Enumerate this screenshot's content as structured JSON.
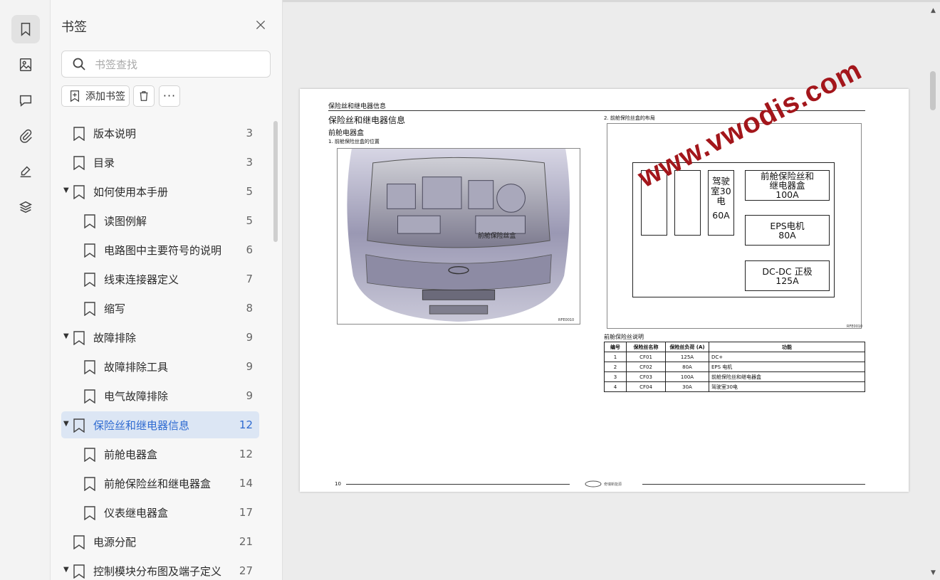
{
  "sidebar_rail": {
    "icons": [
      "bookmark-icon",
      "image-icon",
      "comment-icon",
      "attachment-icon",
      "signature-icon",
      "layers-icon"
    ],
    "active": "bookmark-icon"
  },
  "bookmarks_panel": {
    "title": "书签",
    "search_placeholder": "书签查找",
    "add_label": "添加书签",
    "items": [
      {
        "label": "版本说明",
        "page": "3",
        "level": 0,
        "expanded": false
      },
      {
        "label": "目录",
        "page": "3",
        "level": 0,
        "expanded": false
      },
      {
        "label": "如何使用本手册",
        "page": "5",
        "level": 0,
        "expanded": true
      },
      {
        "label": "读图例解",
        "page": "5",
        "level": 1,
        "expanded": false
      },
      {
        "label": "电路图中主要符号的说明",
        "page": "6",
        "level": 1,
        "expanded": false
      },
      {
        "label": "线束连接器定义",
        "page": "7",
        "level": 1,
        "expanded": false
      },
      {
        "label": "缩写",
        "page": "8",
        "level": 1,
        "expanded": false
      },
      {
        "label": "故障排除",
        "page": "9",
        "level": 0,
        "expanded": true
      },
      {
        "label": "故障排除工具",
        "page": "9",
        "level": 1,
        "expanded": false
      },
      {
        "label": "电气故障排除",
        "page": "9",
        "level": 1,
        "expanded": false
      },
      {
        "label": "保险丝和继电器信息",
        "page": "12",
        "level": 0,
        "expanded": true,
        "selected": true
      },
      {
        "label": "前舱电器盒",
        "page": "12",
        "level": 1,
        "expanded": false
      },
      {
        "label": "前舱保险丝和继电器盒",
        "page": "14",
        "level": 1,
        "expanded": false
      },
      {
        "label": "仪表继电器盒",
        "page": "17",
        "level": 1,
        "expanded": false
      },
      {
        "label": "电源分配",
        "page": "21",
        "level": 0,
        "expanded": false
      },
      {
        "label": "控制模块分布图及端子定义",
        "page": "27",
        "level": 0,
        "expanded": true
      }
    ]
  },
  "document_page": {
    "header": "保险丝和继电器信息",
    "title": "保险丝和继电器信息",
    "subtitle": "前舱电器盒",
    "caption_left": "1.  前舱保险丝盒的位置",
    "caption_right": "2.  前舱保险丝盒的布局",
    "photo_label": "前舱保险丝盒",
    "ref_left": "RFE0010",
    "ref_right": "RFE0010",
    "fuses": {
      "cab": [
        "驾驶",
        "室30",
        "电",
        "60A"
      ],
      "front_box": [
        "前舱保险丝和",
        "继电器盒",
        "100A"
      ],
      "eps": [
        "EPS电机",
        "80A"
      ],
      "dcdc": [
        "DC-DC 正极",
        "125A"
      ]
    },
    "table_title": "前舱保险丝说明",
    "table_headers": [
      "编号",
      "保险丝名称",
      "保险丝负荷 (A)",
      "功能"
    ],
    "table_rows": [
      [
        "1",
        "CF01",
        "125A",
        "DC+"
      ],
      [
        "2",
        "CF02",
        "80A",
        "EPS 电机"
      ],
      [
        "3",
        "CF03",
        "100A",
        "前舱保险丝和继电器盒"
      ],
      [
        "4",
        "CF04",
        "30A",
        "驾驶室30电"
      ]
    ],
    "page_number": "10",
    "footer_brand": "奇瑞新能源",
    "watermark": "www.vwodis.com"
  }
}
